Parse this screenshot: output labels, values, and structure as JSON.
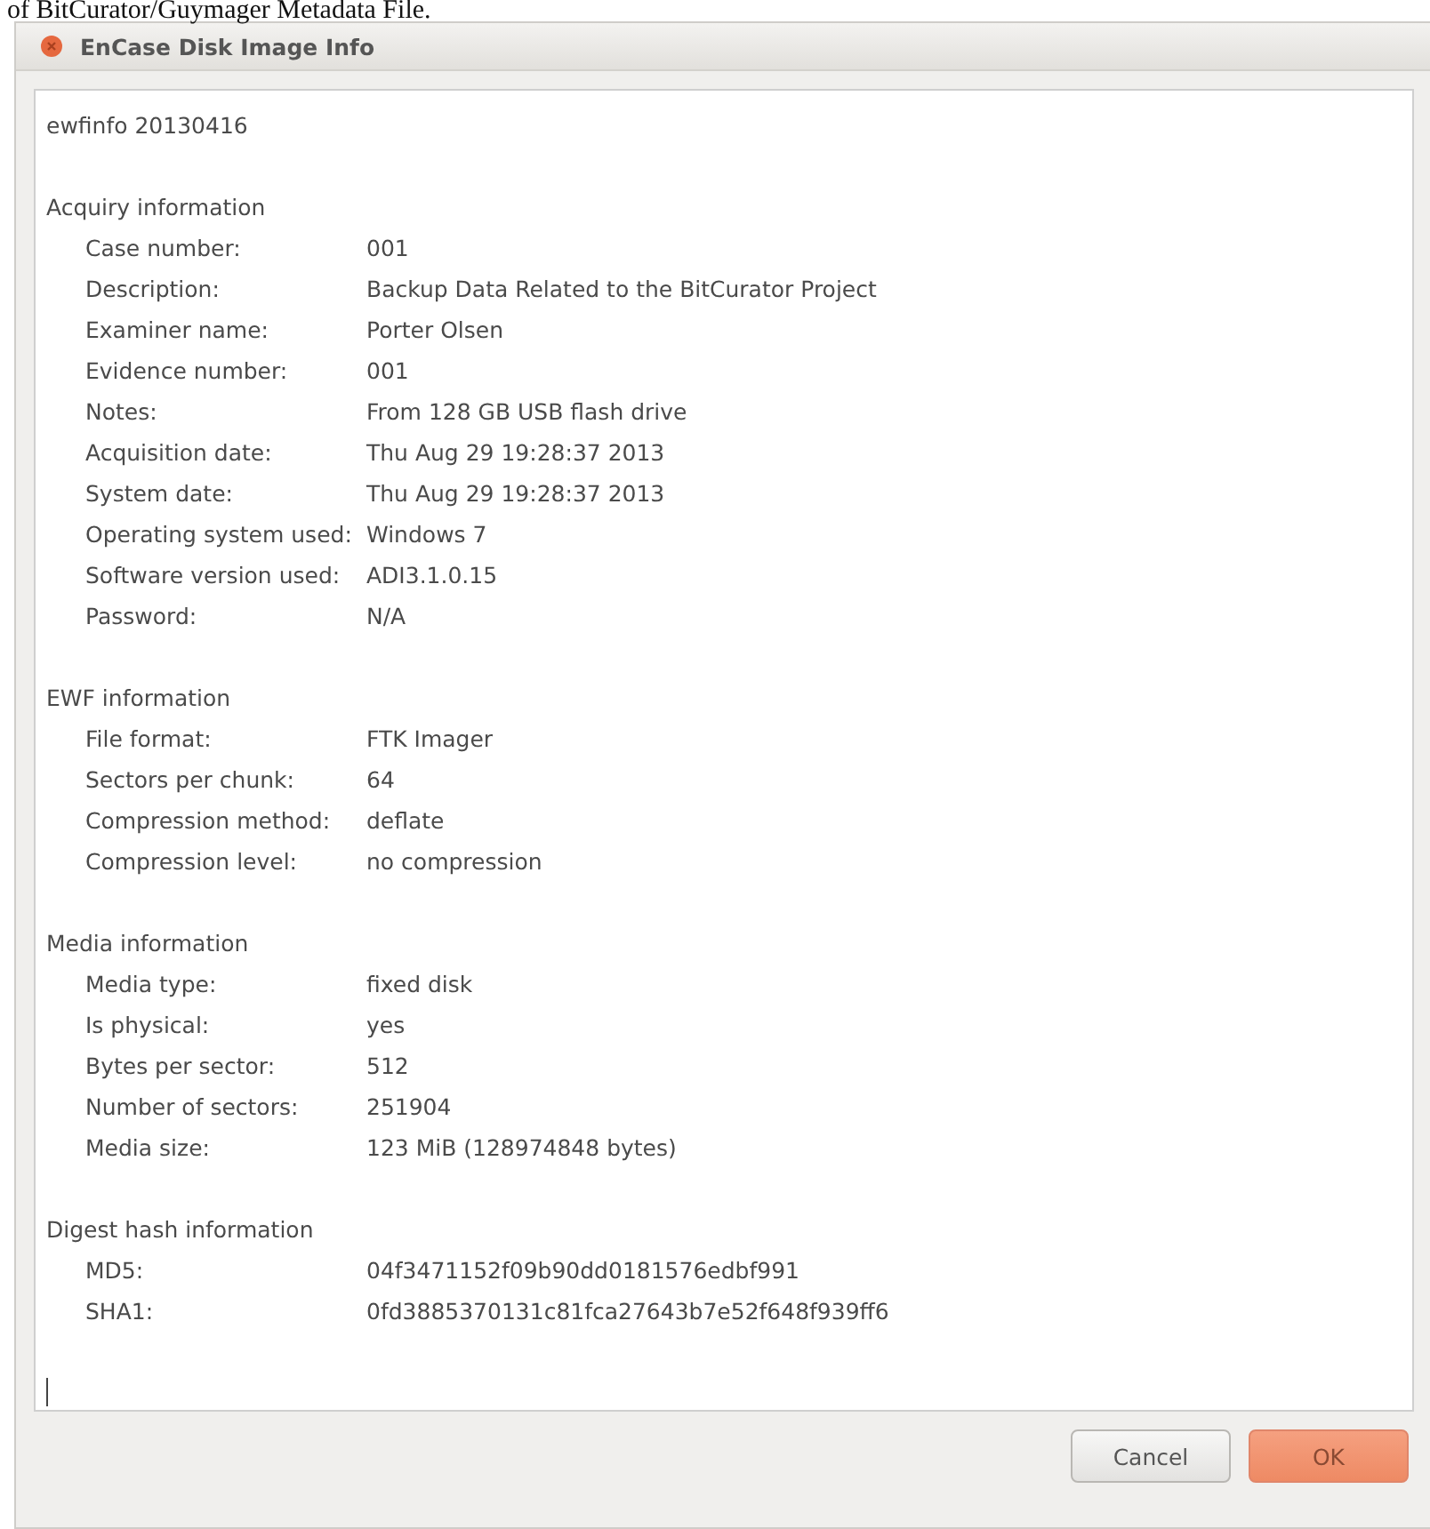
{
  "page_caption": "of BitCurator/Guymager Metadata File.",
  "window": {
    "title": "EnCase Disk Image Info"
  },
  "report": {
    "header": "ewfinfo 20130416",
    "sections": [
      {
        "title": "Acquiry information",
        "rows": [
          {
            "label": "Case number:",
            "value": "001"
          },
          {
            "label": "Description:",
            "value": "Backup Data Related to the BitCurator Project"
          },
          {
            "label": "Examiner name:",
            "value": "Porter Olsen"
          },
          {
            "label": "Evidence number:",
            "value": "001"
          },
          {
            "label": "Notes:",
            "value": "From 128 GB USB flash drive"
          },
          {
            "label": "Acquisition date:",
            "value": "Thu Aug 29 19:28:37 2013"
          },
          {
            "label": "System date:",
            "value": "Thu Aug 29 19:28:37 2013"
          },
          {
            "label": "Operating system used:",
            "value": "Windows 7"
          },
          {
            "label": "Software version used:",
            "value": "ADI3.1.0.15"
          },
          {
            "label": "Password:",
            "value": "N/A"
          }
        ]
      },
      {
        "title": "EWF information",
        "rows": [
          {
            "label": "File format:",
            "value": "FTK Imager"
          },
          {
            "label": "Sectors per chunk:",
            "value": "64"
          },
          {
            "label": "Compression method:",
            "value": "deflate"
          },
          {
            "label": "Compression level:",
            "value": "no compression"
          }
        ]
      },
      {
        "title": "Media information",
        "rows": [
          {
            "label": "Media type:",
            "value": "fixed disk"
          },
          {
            "label": "Is physical:",
            "value": "yes"
          },
          {
            "label": "Bytes per sector:",
            "value": "512"
          },
          {
            "label": "Number of sectors:",
            "value": "251904"
          },
          {
            "label": "Media size:",
            "value": "123 MiB (128974848 bytes)"
          }
        ]
      },
      {
        "title": "Digest hash information",
        "rows": [
          {
            "label": "MD5:",
            "value": "04f3471152f09b90dd0181576edbf991"
          },
          {
            "label": "SHA1:",
            "value": "0fd3885370131c81fca27643b7e52f648f939ff6"
          }
        ]
      }
    ]
  },
  "buttons": [
    {
      "label": "Cancel",
      "kind": "secondary"
    },
    {
      "label": "OK",
      "kind": "primary"
    }
  ]
}
